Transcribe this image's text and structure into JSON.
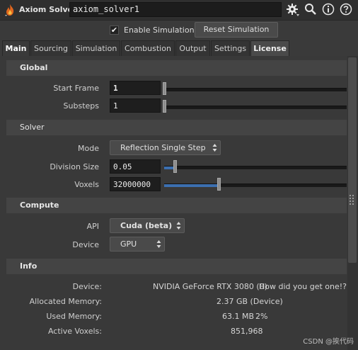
{
  "title_bar": {
    "node_type": "Axiom Solver",
    "node_name": "axiom_solver1"
  },
  "toolbar": {
    "enable_simulation_label": "Enable Simulation",
    "enable_simulation_checked": true,
    "reset_simulation_label": "Reset Simulation"
  },
  "tabs": [
    "Main",
    "Sourcing",
    "Simulation",
    "Combustion",
    "Output",
    "Settings",
    "License"
  ],
  "active_tab": "Main",
  "global": {
    "section_label": "Global",
    "start_frame_label": "Start Frame",
    "start_frame_value": "1",
    "substeps_label": "Substeps",
    "substeps_value": "1"
  },
  "solver": {
    "section_label": "Solver",
    "mode_label": "Mode",
    "mode_value": "Reflection Single Step",
    "division_size_label": "Division Size",
    "division_size_value": "0.05",
    "voxels_label": "Voxels",
    "voxels_value": "32000000"
  },
  "compute": {
    "section_label": "Compute",
    "api_label": "API",
    "api_value": "Cuda (beta)",
    "device_label": "Device",
    "device_value": "GPU"
  },
  "info": {
    "section_label": "Info",
    "device_label": "Device:",
    "device_name": "NVIDIA GeForce RTX 3080 (0)",
    "device_note": "How did you get one!?",
    "allocated_memory_label": "Allocated Memory:",
    "allocated_memory_value": "2.37 GB (Device)",
    "used_memory_label": "Used Memory:",
    "used_memory_value": "63.1 MB",
    "used_memory_percent": "2%",
    "active_voxels_label": "Active Voxels:",
    "active_voxels_value": "851,968"
  },
  "watermark": "CSDN @挨代码",
  "icons": [
    "fire-node-icon",
    "gear-icon",
    "search-icon",
    "info-icon",
    "help-icon"
  ],
  "colors": {
    "slider_fill": "#3c6fb0"
  }
}
